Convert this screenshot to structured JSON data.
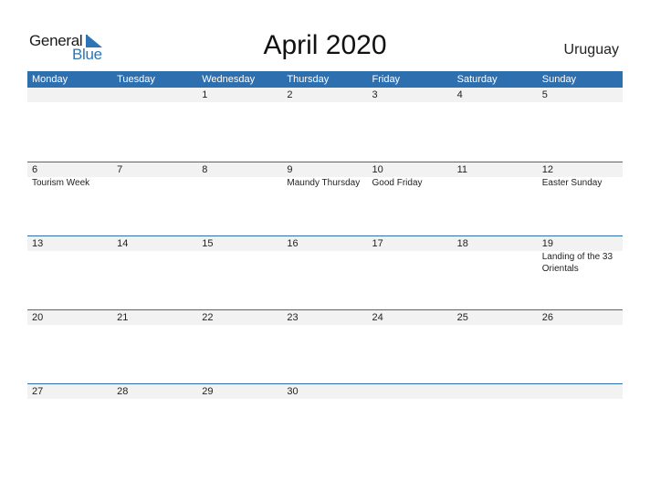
{
  "header": {
    "logo_general": "General",
    "logo_blue": "Blue",
    "title": "April 2020",
    "country": "Uruguay"
  },
  "colors": {
    "accent": "#2e6fb0",
    "logo_blue": "#2e75b6",
    "date_strip": "#f2f2f2"
  },
  "weekdays": [
    "Monday",
    "Tuesday",
    "Wednesday",
    "Thursday",
    "Friday",
    "Saturday",
    "Sunday"
  ],
  "weeks": [
    [
      {
        "day": "",
        "event": ""
      },
      {
        "day": "",
        "event": ""
      },
      {
        "day": "1",
        "event": ""
      },
      {
        "day": "2",
        "event": ""
      },
      {
        "day": "3",
        "event": ""
      },
      {
        "day": "4",
        "event": ""
      },
      {
        "day": "5",
        "event": ""
      }
    ],
    [
      {
        "day": "6",
        "event": "Tourism Week"
      },
      {
        "day": "7",
        "event": ""
      },
      {
        "day": "8",
        "event": ""
      },
      {
        "day": "9",
        "event": "Maundy Thursday"
      },
      {
        "day": "10",
        "event": "Good Friday"
      },
      {
        "day": "11",
        "event": ""
      },
      {
        "day": "12",
        "event": "Easter Sunday"
      }
    ],
    [
      {
        "day": "13",
        "event": ""
      },
      {
        "day": "14",
        "event": ""
      },
      {
        "day": "15",
        "event": ""
      },
      {
        "day": "16",
        "event": ""
      },
      {
        "day": "17",
        "event": ""
      },
      {
        "day": "18",
        "event": ""
      },
      {
        "day": "19",
        "event": "Landing of the 33 Orientals"
      }
    ],
    [
      {
        "day": "20",
        "event": ""
      },
      {
        "day": "21",
        "event": ""
      },
      {
        "day": "22",
        "event": ""
      },
      {
        "day": "23",
        "event": ""
      },
      {
        "day": "24",
        "event": ""
      },
      {
        "day": "25",
        "event": ""
      },
      {
        "day": "26",
        "event": ""
      }
    ],
    [
      {
        "day": "27",
        "event": ""
      },
      {
        "day": "28",
        "event": ""
      },
      {
        "day": "29",
        "event": ""
      },
      {
        "day": "30",
        "event": ""
      },
      {
        "day": "",
        "event": ""
      },
      {
        "day": "",
        "event": ""
      },
      {
        "day": "",
        "event": ""
      }
    ]
  ]
}
